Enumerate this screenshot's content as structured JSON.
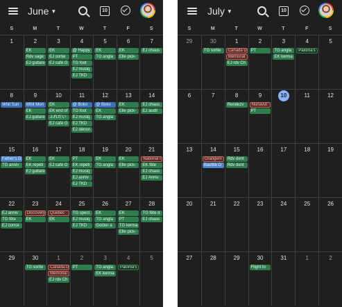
{
  "weekdays": [
    "S",
    "M",
    "T",
    "W",
    "T",
    "F",
    "S"
  ],
  "june": {
    "title": "June",
    "weeks": [
      {
        "days": [
          {
            "num": "1"
          },
          {
            "num": "2",
            "events": [
              {
                "t": "EK",
                "c": "green"
              },
              {
                "t": "Rdv sage",
                "c": "green"
              },
              {
                "t": "EJ guitare",
                "c": "green"
              }
            ]
          },
          {
            "num": "3",
            "events": [
              {
                "t": "EK",
                "c": "green"
              },
              {
                "t": "EJ sortie",
                "c": "green"
              },
              {
                "t": "EJ café G",
                "c": "green"
              }
            ]
          },
          {
            "num": "4",
            "events": [
              {
                "t": "@ Happy",
                "c": "green"
              },
              {
                "t": "PT",
                "c": "green"
              },
              {
                "t": "TG foot",
                "c": "green"
              },
              {
                "t": "EJ musiq",
                "c": "green"
              },
              {
                "t": "EJ TKD",
                "c": "green"
              }
            ]
          },
          {
            "num": "5",
            "events": [
              {
                "t": "EK",
                "c": "green"
              },
              {
                "t": "TG angla",
                "c": "green"
              }
            ]
          },
          {
            "num": "6",
            "events": [
              {
                "t": "EK",
                "c": "green"
              },
              {
                "t": "Elle pick-",
                "c": "green"
              }
            ]
          },
          {
            "num": "7",
            "events": [
              {
                "t": "EJ chaus",
                "c": "green"
              }
            ]
          }
        ]
      },
      {
        "days": [
          {
            "num": "8",
            "events": [
              {
                "t": "Whit Sun",
                "c": "blue"
              }
            ]
          },
          {
            "num": "9",
            "events": [
              {
                "t": "Whit Mon",
                "c": "blue"
              },
              {
                "t": "EK",
                "c": "green"
              },
              {
                "t": "EJ guitare",
                "c": "green"
              }
            ]
          },
          {
            "num": "10",
            "events": [
              {
                "t": "EK",
                "c": "green"
              },
              {
                "t": "EK end of",
                "c": "green"
              },
              {
                "t": "ふれだい",
                "c": "green"
              },
              {
                "t": "EJ café G",
                "c": "green"
              }
            ]
          },
          {
            "num": "11",
            "events": [
              {
                "t": "@ Boko",
                "c": "blue"
              },
              {
                "t": "TG foot",
                "c": "green"
              },
              {
                "t": "EJ musiq",
                "c": "green"
              },
              {
                "t": "EJ TKD",
                "c": "green"
              },
              {
                "t": "EJ dénon",
                "c": "green"
              }
            ]
          },
          {
            "num": "12",
            "events": [
              {
                "t": "@ Boko",
                "c": "blue"
              },
              {
                "t": "EK",
                "c": "green"
              },
              {
                "t": "TG angla",
                "c": "green"
              }
            ]
          },
          {
            "num": "13",
            "events": [
              {
                "t": "EK",
                "c": "green"
              },
              {
                "t": "Elle pick-",
                "c": "green"
              }
            ]
          },
          {
            "num": "14",
            "events": [
              {
                "t": "EJ chaus",
                "c": "green"
              },
              {
                "t": "EJ audit",
                "c": "green"
              }
            ]
          }
        ]
      },
      {
        "days": [
          {
            "num": "15",
            "events": [
              {
                "t": "Father's D",
                "c": "lightblue"
              },
              {
                "t": "TG anniv",
                "c": "green"
              }
            ]
          },
          {
            "num": "16",
            "events": [
              {
                "t": "EK",
                "c": "green"
              },
              {
                "t": "EK répéti",
                "c": "green"
              },
              {
                "t": "EJ guitare",
                "c": "green"
              }
            ]
          },
          {
            "num": "17",
            "events": [
              {
                "t": "EK",
                "c": "green"
              },
              {
                "t": "EJ café G",
                "c": "green"
              }
            ]
          },
          {
            "num": "18",
            "events": [
              {
                "t": "PT",
                "c": "green"
              },
              {
                "t": "EK répéti",
                "c": "green"
              },
              {
                "t": "EJ musiq",
                "c": "green"
              },
              {
                "t": "EJ anniv",
                "c": "green"
              },
              {
                "t": "EJ TKD",
                "c": "green"
              }
            ]
          },
          {
            "num": "19",
            "events": [
              {
                "t": "EK",
                "c": "green"
              },
              {
                "t": "TG angla",
                "c": "green"
              }
            ]
          },
          {
            "num": "20",
            "events": [
              {
                "t": "EK",
                "c": "green"
              },
              {
                "t": "Elle pick-",
                "c": "green"
              }
            ]
          },
          {
            "num": "21",
            "events": [
              {
                "t": "National I",
                "c": "red"
              },
              {
                "t": "EK fête",
                "c": "green"
              },
              {
                "t": "EJ chaus",
                "c": "green"
              },
              {
                "t": "EJ Anniv",
                "c": "green"
              }
            ]
          }
        ]
      },
      {
        "days": [
          {
            "num": "22",
            "events": [
              {
                "t": "EJ anniv",
                "c": "green"
              },
              {
                "t": "TG fête",
                "c": "green"
              },
              {
                "t": "EJ conce",
                "c": "green"
              }
            ]
          },
          {
            "num": "23",
            "events": [
              {
                "t": "Discovery",
                "c": "red"
              },
              {
                "t": "EK",
                "c": "green"
              }
            ]
          },
          {
            "num": "24",
            "events": [
              {
                "t": "Quebec",
                "c": "red"
              },
              {
                "t": "EK",
                "c": "green"
              }
            ]
          },
          {
            "num": "25",
            "events": [
              {
                "t": "TG spect",
                "c": "green"
              },
              {
                "t": "EJ musiq",
                "c": "green"
              },
              {
                "t": "EJ TKD",
                "c": "green"
              }
            ]
          },
          {
            "num": "26",
            "events": [
              {
                "t": "EK",
                "c": "green"
              },
              {
                "t": "TG angla",
                "c": "green"
              },
              {
                "t": "Goûter a",
                "c": "green"
              }
            ]
          },
          {
            "num": "27",
            "events": [
              {
                "t": "EK",
                "c": "green"
              },
              {
                "t": "PT",
                "c": "green"
              },
              {
                "t": "TG kerma",
                "c": "green"
              },
              {
                "t": "Elle pick-",
                "c": "green"
              }
            ]
          },
          {
            "num": "28",
            "events": [
              {
                "t": "TG fête d",
                "c": "green"
              },
              {
                "t": "EJ chaus",
                "c": "green"
              }
            ]
          }
        ]
      },
      {
        "days": [
          {
            "num": "29"
          },
          {
            "num": "30",
            "events": [
              {
                "t": "TG sortie",
                "c": "green"
              }
            ]
          },
          {
            "num": "1",
            "dim": true,
            "events": [
              {
                "t": "Canada D",
                "c": "red"
              },
              {
                "t": "Memorial",
                "c": "red"
              },
              {
                "t": "EJ rdv Ch",
                "c": "green"
              }
            ]
          },
          {
            "num": "2",
            "dim": true,
            "events": [
              {
                "t": "PT",
                "c": "green"
              }
            ]
          },
          {
            "num": "3",
            "dim": true,
            "events": [
              {
                "t": "TG angla",
                "c": "green"
              },
              {
                "t": "EK kerma",
                "c": "green"
              }
            ]
          },
          {
            "num": "4",
            "dim": true,
            "events": [
              {
                "t": "Paloma's",
                "c": "outline-green"
              }
            ]
          },
          {
            "num": "5",
            "dim": true
          }
        ]
      }
    ]
  },
  "july": {
    "title": "July",
    "weeks": [
      {
        "days": [
          {
            "num": "29",
            "dim": true
          },
          {
            "num": "30",
            "dim": true,
            "events": [
              {
                "t": "TG sortie",
                "c": "green"
              }
            ]
          },
          {
            "num": "1",
            "events": [
              {
                "t": "Canada D",
                "c": "red"
              },
              {
                "t": "Memorial",
                "c": "red"
              },
              {
                "t": "EJ rdv Ch",
                "c": "green"
              }
            ]
          },
          {
            "num": "2",
            "events": [
              {
                "t": "PT",
                "c": "green"
              }
            ]
          },
          {
            "num": "3",
            "events": [
              {
                "t": "TG angla",
                "c": "green"
              },
              {
                "t": "EK kerma",
                "c": "green"
              }
            ]
          },
          {
            "num": "4",
            "events": [
              {
                "t": "Paloma's",
                "c": "outline-green"
              }
            ]
          },
          {
            "num": "5"
          }
        ]
      },
      {
        "days": [
          {
            "num": "6"
          },
          {
            "num": "7"
          },
          {
            "num": "8",
            "events": [
              {
                "t": "Rendezv",
                "c": "green"
              }
            ]
          },
          {
            "num": "9",
            "events": [
              {
                "t": "Nunavut",
                "c": "red"
              },
              {
                "t": "PT",
                "c": "green"
              }
            ]
          },
          {
            "num": "10",
            "today": true
          },
          {
            "num": "11"
          },
          {
            "num": "12"
          }
        ]
      },
      {
        "days": [
          {
            "num": "13"
          },
          {
            "num": "14",
            "events": [
              {
                "t": "Orangem",
                "c": "red"
              },
              {
                "t": "Bastille D",
                "c": "lightblue"
              }
            ]
          },
          {
            "num": "15",
            "events": [
              {
                "t": "Rdv dent",
                "c": "green"
              },
              {
                "t": "Rdv dent",
                "c": "green"
              }
            ]
          },
          {
            "num": "16"
          },
          {
            "num": "17"
          },
          {
            "num": "18"
          },
          {
            "num": "19"
          }
        ]
      },
      {
        "days": [
          {
            "num": "20"
          },
          {
            "num": "21"
          },
          {
            "num": "22"
          },
          {
            "num": "23"
          },
          {
            "num": "24"
          },
          {
            "num": "25"
          },
          {
            "num": "26"
          }
        ]
      },
      {
        "days": [
          {
            "num": "27"
          },
          {
            "num": "28"
          },
          {
            "num": "29"
          },
          {
            "num": "30",
            "events": [
              {
                "t": "Flight to",
                "c": "green"
              }
            ]
          },
          {
            "num": "31"
          },
          {
            "num": "1",
            "dim": true
          },
          {
            "num": "2",
            "dim": true
          }
        ]
      }
    ]
  }
}
